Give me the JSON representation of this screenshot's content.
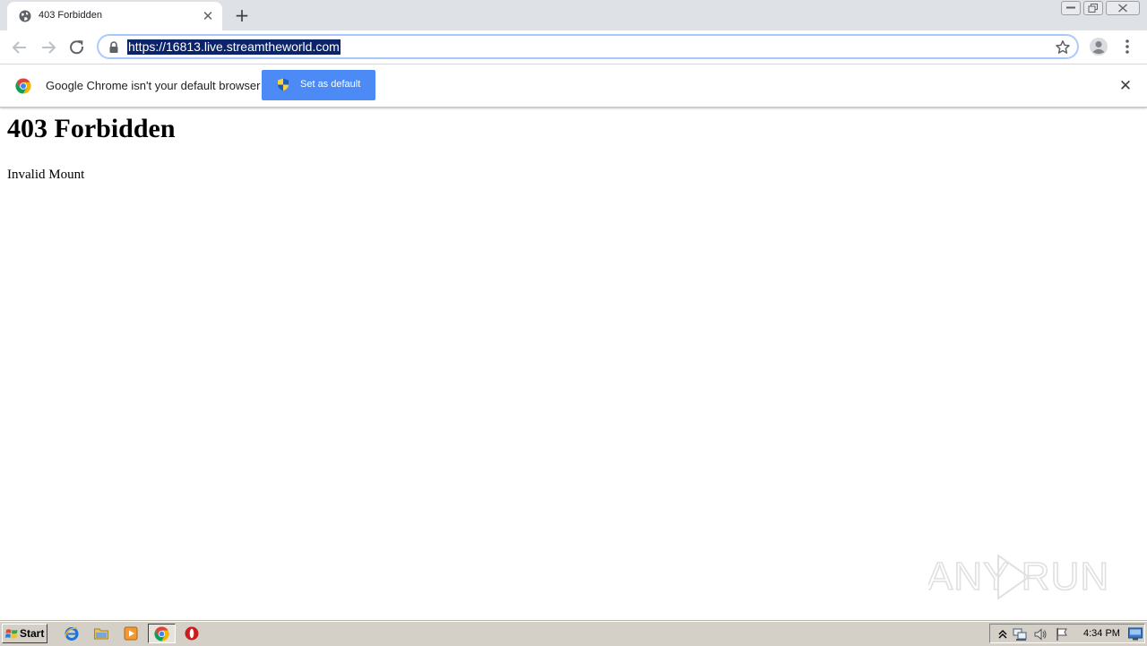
{
  "browser": {
    "tab": {
      "title": "403 Forbidden",
      "close_glyph": "✕"
    },
    "new_tab_glyph": "+",
    "address_bar": {
      "url": "https://16813.live.streamtheworld.com"
    }
  },
  "infobar": {
    "message": "Google Chrome isn't your default browser",
    "button_label": "Set as default",
    "close_glyph": "✕"
  },
  "page": {
    "heading": "403 Forbidden",
    "body": "Invalid Mount"
  },
  "watermark": {
    "text": "ANY RUN"
  },
  "taskbar": {
    "start_label": "Start",
    "clock": "4:34 PM"
  },
  "colors": {
    "accent_button": "#4c8bf5",
    "url_highlight": "#0a246a",
    "tabstrip": "#dee1e6",
    "taskbar": "#d4d0c8"
  },
  "icons": [
    "globe-icon",
    "tab-close-icon",
    "new-tab-icon",
    "back-arrow-icon",
    "forward-arrow-icon",
    "reload-icon",
    "lock-icon",
    "star-icon",
    "profile-icon",
    "kebab-menu-icon",
    "chrome-logo-icon",
    "uac-shield-icon",
    "close-icon",
    "windows-logo-icon",
    "ie-icon",
    "folder-icon",
    "media-player-icon",
    "chrome-icon",
    "opera-icon",
    "chevron-up-icon",
    "network-icon",
    "volume-icon",
    "flag-icon",
    "show-desktop-icon"
  ]
}
